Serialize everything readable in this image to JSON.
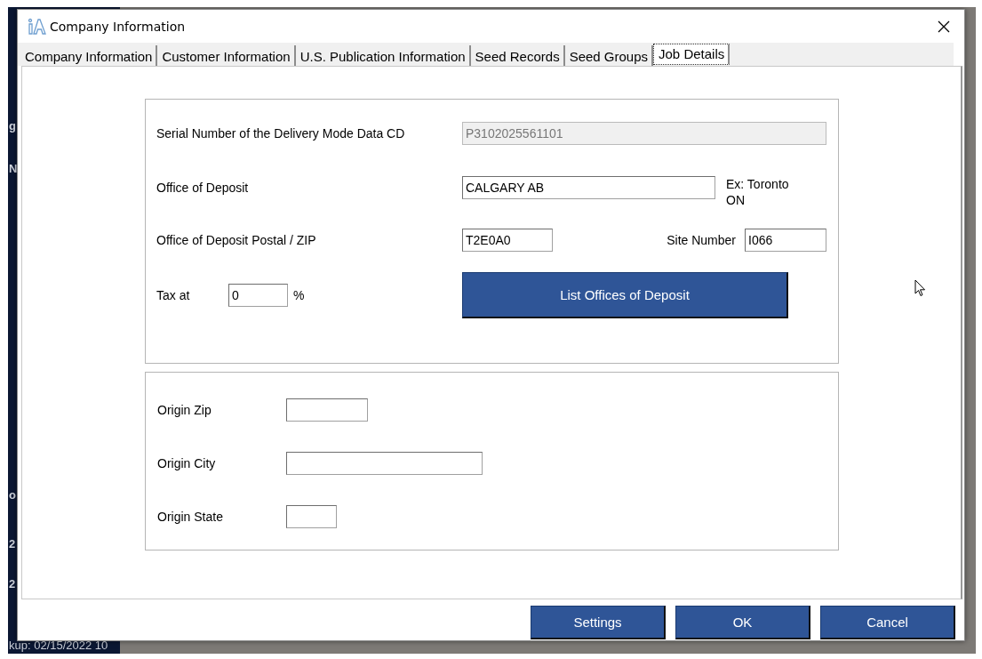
{
  "background": {
    "texts": [
      "g",
      "N",
      "o",
      "2",
      "2"
    ],
    "status": "kup: 02/15/2022 10"
  },
  "window": {
    "title": "Company Information"
  },
  "tabs": [
    {
      "label": "Company Information",
      "selected": false
    },
    {
      "label": "Customer Information",
      "selected": false
    },
    {
      "label": "U.S. Publication Information",
      "selected": false
    },
    {
      "label": "Seed Records",
      "selected": false
    },
    {
      "label": "Seed Groups",
      "selected": false
    },
    {
      "label": "Job Details",
      "selected": true
    }
  ],
  "deposit_panel": {
    "serial": {
      "label": "Serial Number of the Delivery Mode Data CD",
      "value": "P3102025561101",
      "disabled": true
    },
    "office": {
      "label": "Office of Deposit",
      "value": "CALGARY AB",
      "hint": "Ex: Toronto ON"
    },
    "postal": {
      "label": "Office of Deposit Postal / ZIP",
      "value": "T2E0A0"
    },
    "site": {
      "label": "Site Number",
      "value": "I066"
    },
    "tax": {
      "label": "Tax at",
      "value": "0",
      "unit": "%"
    },
    "list_button": "List Offices of Deposit"
  },
  "origin_panel": {
    "fields": [
      {
        "label": "Origin Zip",
        "kind": "zip"
      },
      {
        "label": "Origin City",
        "kind": "city"
      },
      {
        "label": "Origin State",
        "kind": "state"
      }
    ]
  },
  "buttons": [
    "Settings",
    "OK",
    "Cancel"
  ]
}
